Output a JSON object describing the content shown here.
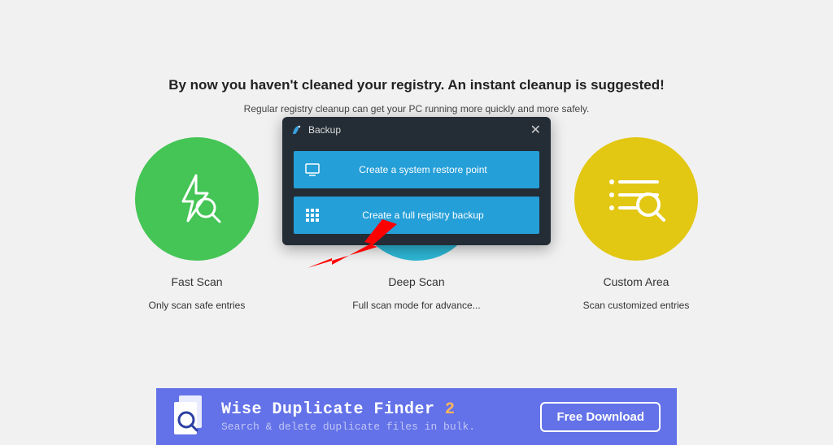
{
  "heading": "By now you haven't cleaned your registry. An instant cleanup is suggested!",
  "subheading": "Regular registry cleanup can get your PC running more quickly and more safely.",
  "circles": [
    {
      "title": "Fast Scan",
      "desc": "Only scan safe entries"
    },
    {
      "title": "Deep Scan",
      "desc": "Full scan mode for advance..."
    },
    {
      "title": "Custom Area",
      "desc": "Scan customized entries"
    }
  ],
  "modal": {
    "title": "Backup",
    "btn1": "Create a system restore point",
    "btn2": "Create a full registry backup"
  },
  "banner": {
    "title_white": "Wise Duplicate Finder ",
    "title_orange": "2",
    "subtitle": "Search & delete duplicate files in bulk.",
    "cta": "Free Download"
  }
}
